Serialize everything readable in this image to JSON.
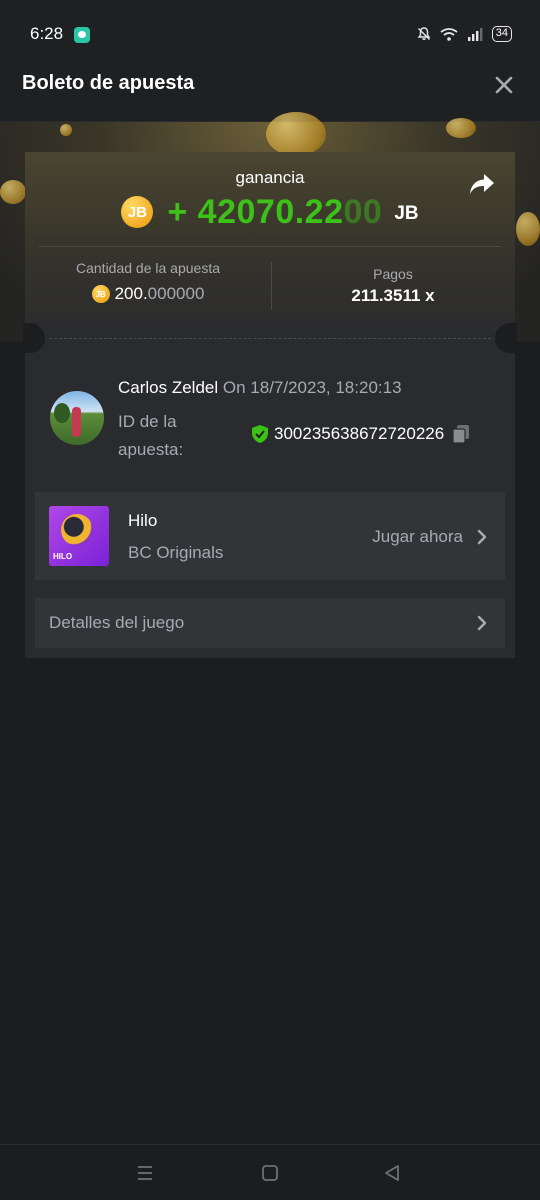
{
  "status_bar": {
    "time": "6:28",
    "battery": "34",
    "icons": [
      "app-notification-icon",
      "mute-icon",
      "wifi-icon",
      "signal-icon",
      "battery-icon"
    ]
  },
  "header": {
    "title": "Boleto de apuesta",
    "close_icon": "close-icon"
  },
  "win": {
    "label": "ganancia",
    "coin_label": "JB",
    "amount_main": "+ 42070.22",
    "amount_faded": "00",
    "currency": "JB",
    "share_icon": "share-icon"
  },
  "stats": {
    "bet_amount_label": "Cantidad de la apuesta",
    "bet_amount_main": "200.",
    "bet_amount_faded": "000000",
    "coin_label": "JB",
    "payout_label": "Pagos",
    "payout_value": "211.3511 x"
  },
  "bet_info": {
    "user_name": "Carlos Zeldel",
    "date_text": " On 18/7/2023, 18:20:13",
    "bet_id_label": "ID de la apuesta:",
    "bet_id_value": "300235638672720226"
  },
  "game": {
    "name": "Hilo",
    "provider": "BC Originals",
    "thumb_text": "HILO",
    "play_label": "Jugar ahora"
  },
  "details": {
    "label": "Detalles del juego"
  },
  "colors": {
    "background": "#1c1d1f",
    "card": "#2a2b2e",
    "row": "#323437",
    "win_green": "#3bc117",
    "muted_text": "#a8aab0",
    "coin_gold": "#f0a81f",
    "shield_green": "#3bc117"
  }
}
